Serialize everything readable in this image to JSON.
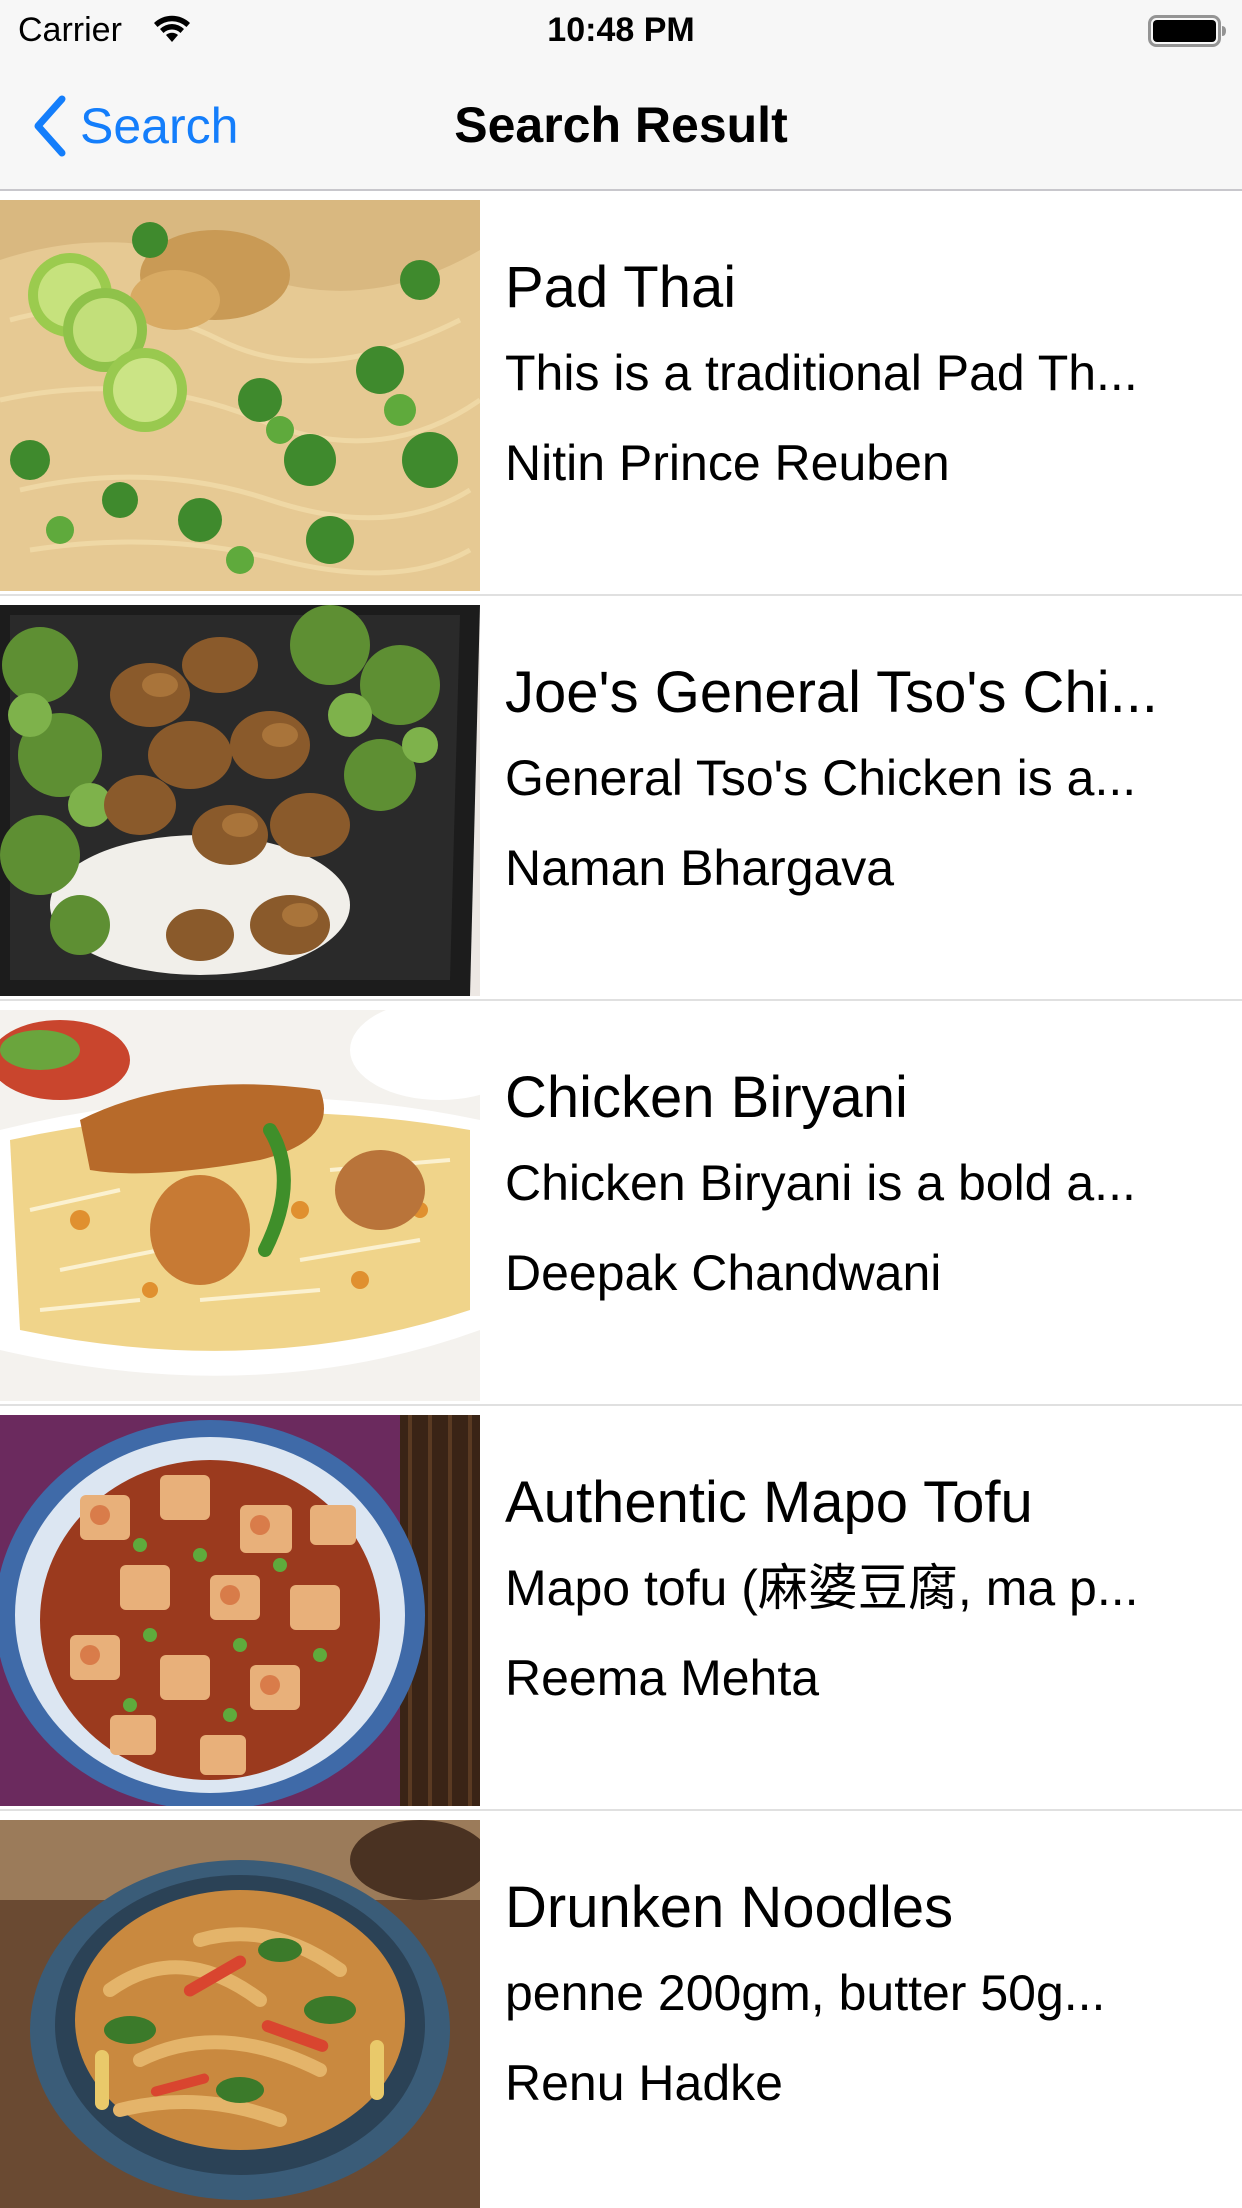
{
  "status_bar": {
    "carrier": "Carrier",
    "time": "10:48 PM",
    "wifi_icon": "wifi-icon",
    "battery_icon": "battery-full-icon"
  },
  "nav": {
    "back_label": "Search",
    "back_icon": "chevron-left-icon",
    "title": "Search Result",
    "accent_color": "#147efb"
  },
  "results": [
    {
      "title": "Pad Thai",
      "description": "This is a traditional Pad Th...",
      "author": "Nitin Prince Reuben",
      "image": "pad-thai-photo"
    },
    {
      "title": "Joe's General Tso's Chi...",
      "description": "General Tso's Chicken is a...",
      "author": "Naman Bhargava",
      "image": "general-tso-chicken-photo"
    },
    {
      "title": "Chicken Biryani",
      "description": "Chicken Biryani is a bold a...",
      "author": "Deepak Chandwani",
      "image": "chicken-biryani-photo"
    },
    {
      "title": "Authentic Mapo Tofu",
      "description": "Mapo tofu (麻婆豆腐, ma p...",
      "author": "Reema Mehta",
      "image": "mapo-tofu-photo"
    },
    {
      "title": "Drunken Noodles",
      "description": "penne 200gm, butter 50g...",
      "author": "Renu Hadke",
      "image": "drunken-noodles-photo"
    }
  ]
}
